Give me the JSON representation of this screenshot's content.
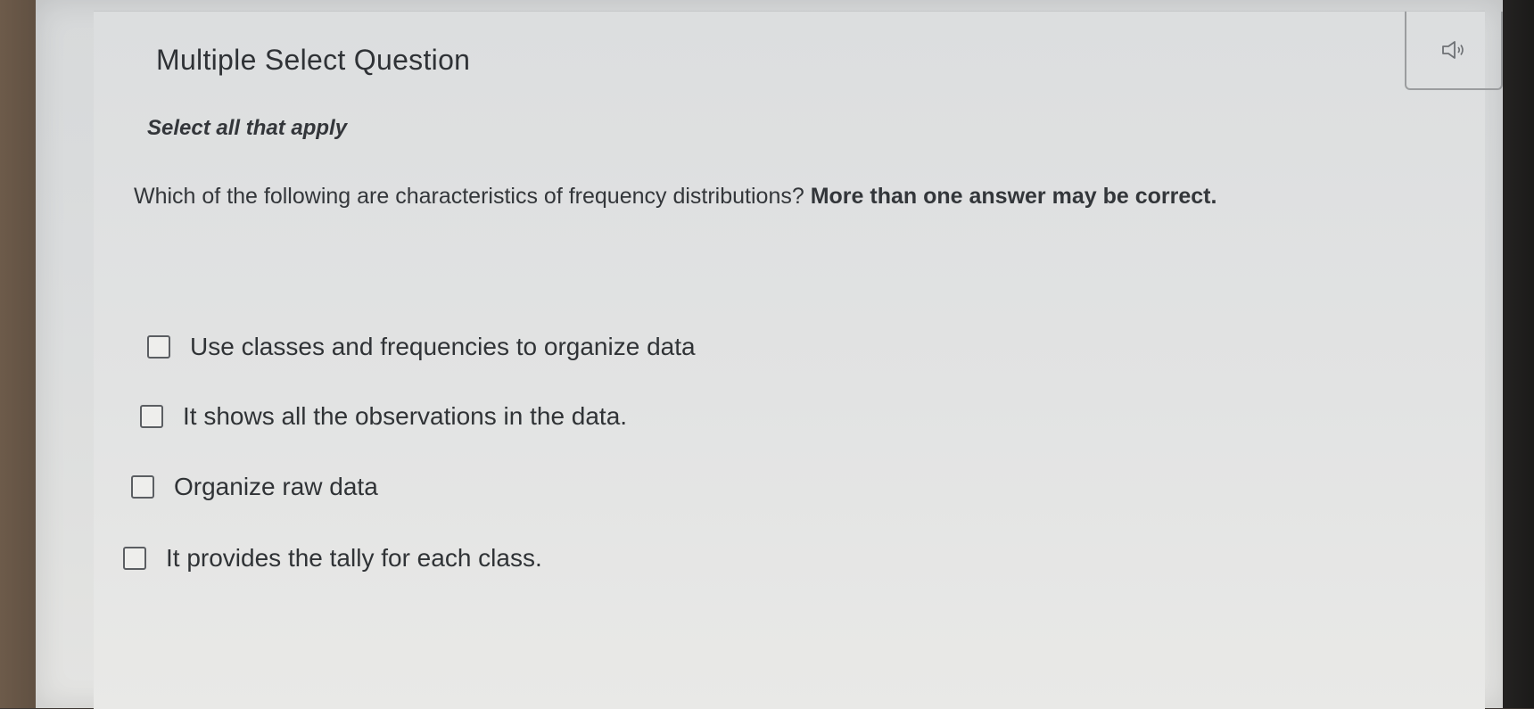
{
  "header": {
    "title": "Multiple Select Question",
    "audio_icon": "speaker-icon"
  },
  "instruction": "Select all that apply",
  "question": {
    "text_plain": "Which of the following are characteristics of frequency distributions? ",
    "text_emphasis": "More than one answer may be correct."
  },
  "options": [
    {
      "label": "Use classes and frequencies to organize data",
      "checked": false
    },
    {
      "label": "It shows all the observations in the data.",
      "checked": false
    },
    {
      "label": "Organize raw data",
      "checked": false
    },
    {
      "label": "It provides the tally for each class.",
      "checked": false
    }
  ],
  "colors": {
    "text": "#33363a",
    "panel": "#e2e3e3",
    "checkbox_border": "#5b5e62"
  }
}
